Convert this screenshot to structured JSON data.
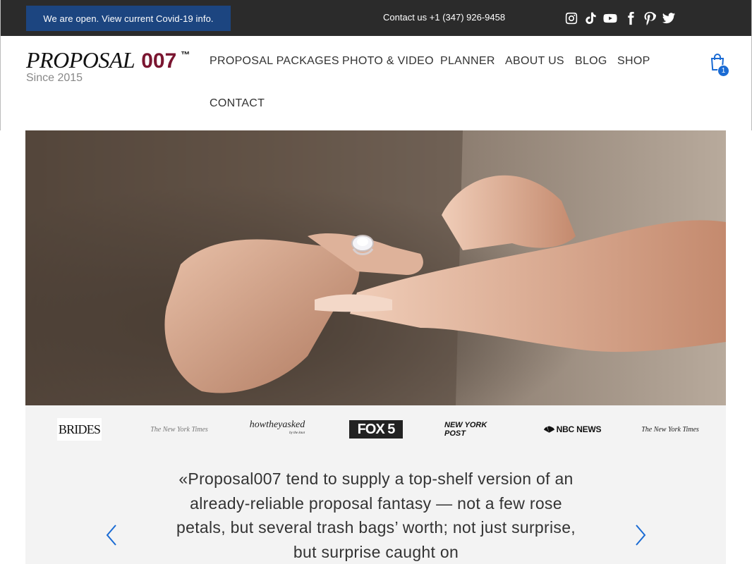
{
  "topbar": {
    "covid_label": "We are open. View current Covid-19 info.",
    "contact_label": "Contact us +1 (347) 926-9458",
    "social": [
      "instagram-icon",
      "tiktok-icon",
      "youtube-icon",
      "facebook-icon",
      "pinterest-icon",
      "twitter-icon"
    ]
  },
  "brand": {
    "logo_text": "PROPOSAL",
    "logo_number": "007",
    "logo_tm": "™",
    "since": "Since 2015",
    "accent_color": "#7a1530"
  },
  "nav": {
    "items": [
      "PROPOSAL PACKAGES",
      "PHOTO & VIDEO",
      "PLANNER",
      "ABOUT US",
      "BLOG",
      "SHOP",
      "CONTACT"
    ]
  },
  "cart": {
    "count": "1",
    "color": "#1a6bd4"
  },
  "press": {
    "logos": [
      "BRIDES",
      "The New York Times",
      "howtheyasked",
      "by the knot",
      "FOX 5",
      "NEW YORK POST",
      "NBC NEWS",
      "The New York Times"
    ]
  },
  "testimonial": {
    "quote": "«Proposal007 tend to supply a top-shelf version of an already-reliable proposal fantasy — not a few rose petals, but several trash bags’ worth; not just surprise, but surprise caught on"
  }
}
